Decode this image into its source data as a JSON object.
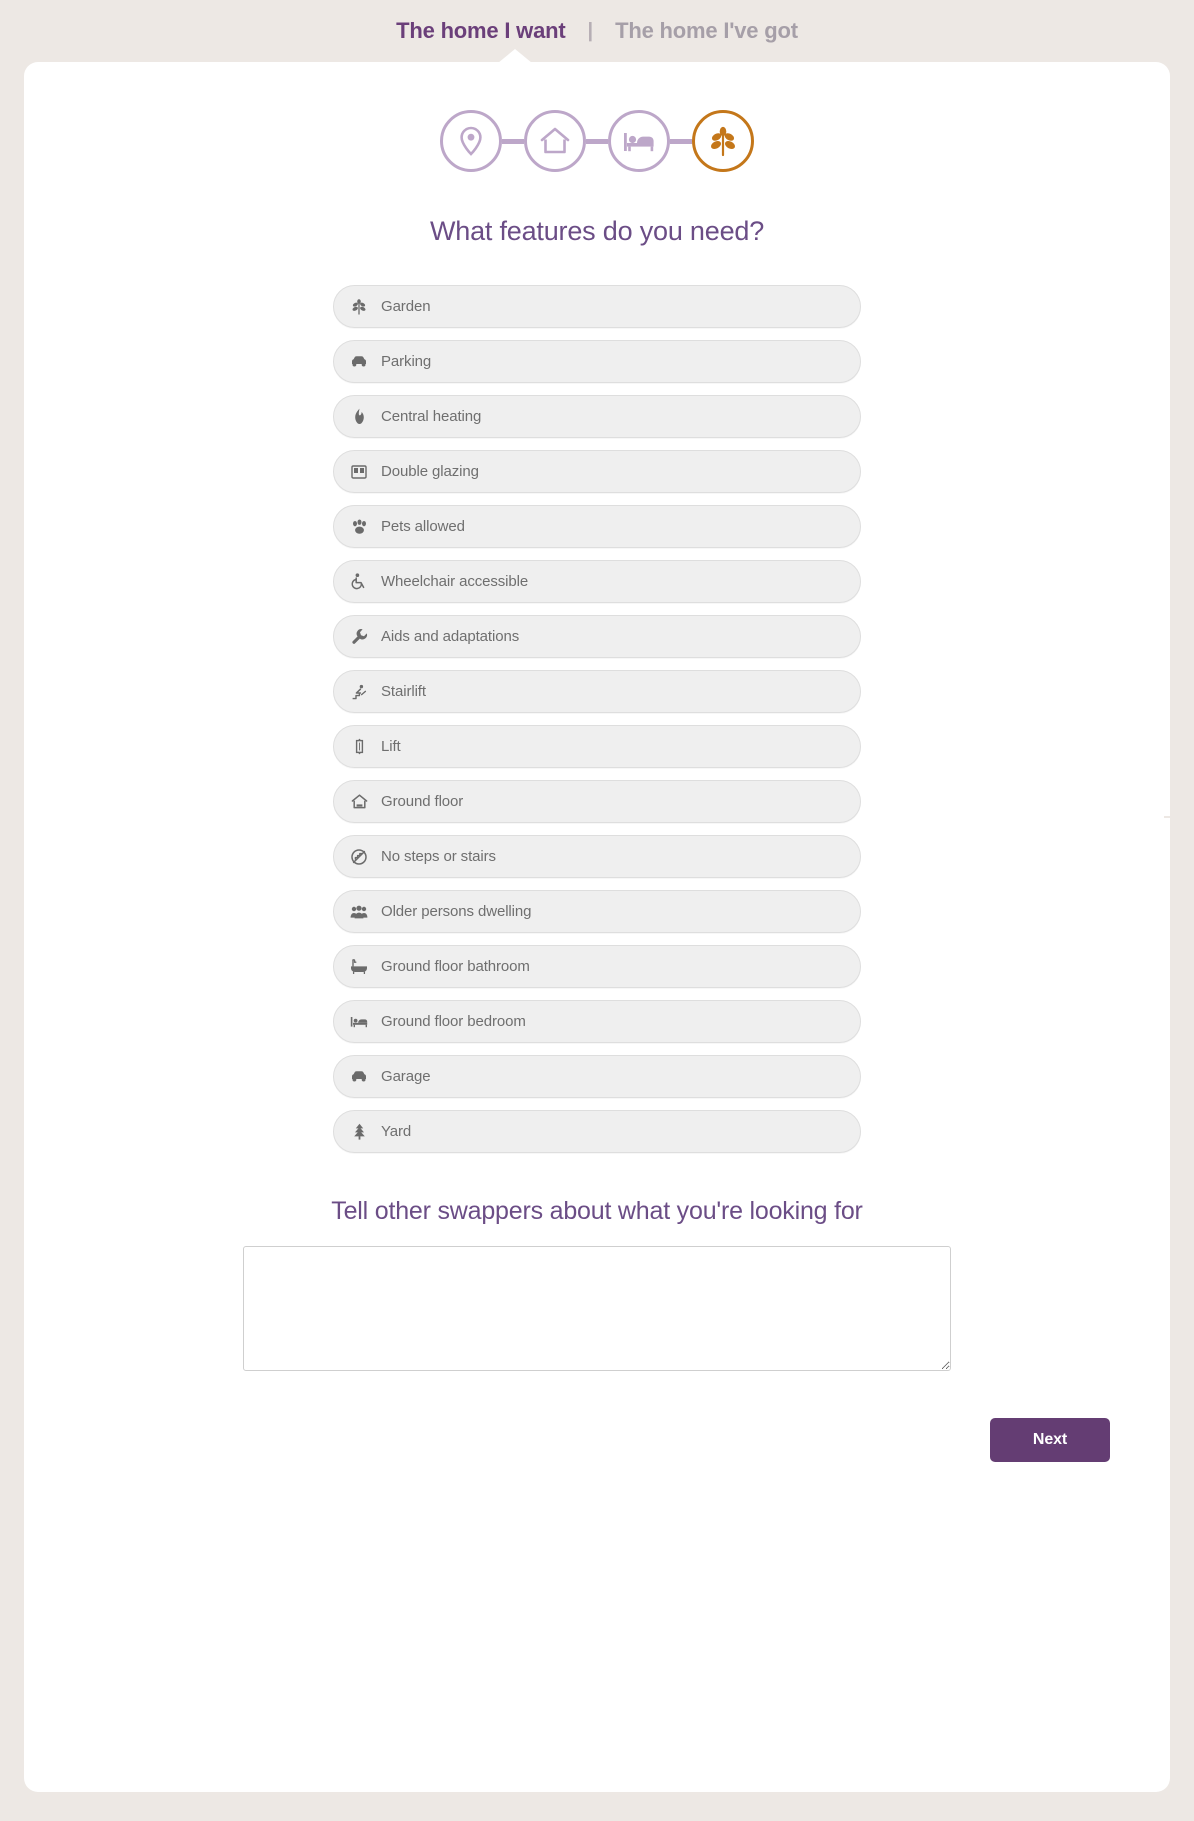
{
  "tabs": [
    {
      "label": "The home I want",
      "active": true
    },
    {
      "label": "The home I've got",
      "active": false
    }
  ],
  "tab_separator": "|",
  "steps": [
    {
      "name": "location",
      "icon": "map-pin-icon",
      "active": false
    },
    {
      "name": "property",
      "icon": "house-icon",
      "active": false
    },
    {
      "name": "bedrooms",
      "icon": "bed-icon",
      "active": false
    },
    {
      "name": "features",
      "icon": "leaf-icon",
      "active": true
    }
  ],
  "main": {
    "question_title": "What features do you need?",
    "features": [
      {
        "label": "Garden",
        "icon": "leaf-icon"
      },
      {
        "label": "Parking",
        "icon": "car-icon"
      },
      {
        "label": "Central heating",
        "icon": "flame-icon"
      },
      {
        "label": "Double glazing",
        "icon": "window-icon"
      },
      {
        "label": "Pets allowed",
        "icon": "paw-icon"
      },
      {
        "label": "Wheelchair accessible",
        "icon": "wheelchair-icon"
      },
      {
        "label": "Aids and adaptations",
        "icon": "wrench-icon"
      },
      {
        "label": "Stairlift",
        "icon": "stairlift-icon"
      },
      {
        "label": "Lift",
        "icon": "elevator-icon"
      },
      {
        "label": "Ground floor",
        "icon": "ground-floor-house-icon"
      },
      {
        "label": "No steps or stairs",
        "icon": "no-steps-icon"
      },
      {
        "label": "Older persons dwelling",
        "icon": "people-group-icon"
      },
      {
        "label": "Ground floor bathroom",
        "icon": "bathtub-icon"
      },
      {
        "label": "Ground floor bedroom",
        "icon": "bed-icon"
      },
      {
        "label": "Garage",
        "icon": "car-icon"
      },
      {
        "label": "Yard",
        "icon": "tree-icon"
      }
    ],
    "notes_title": "Tell other swappers about what you're looking for",
    "notes_value": "",
    "notes_placeholder": ""
  },
  "footer": {
    "next_label": "Next"
  },
  "colors": {
    "page_background": "#ede8e4",
    "card_background": "#ffffff",
    "accent_purple": "#6b3f7a",
    "heading_purple": "#6b4d86",
    "step_inactive": "#bda7c9",
    "step_active": "#c4771a",
    "inactive_tab": "#a69fa8",
    "pill_background": "#efefef",
    "pill_border": "#dedede",
    "pill_text": "#6f6f6f",
    "button_purple": "#643d73"
  }
}
